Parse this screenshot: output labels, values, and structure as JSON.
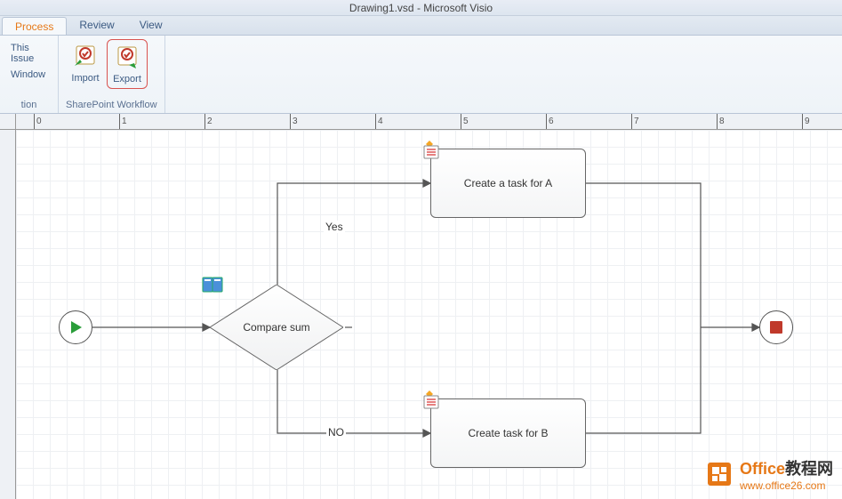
{
  "title": "Drawing1.vsd  -  Microsoft Visio",
  "tabs": [
    "Process",
    "Review",
    "View"
  ],
  "active_tab": "Process",
  "ribbon": {
    "group1": {
      "label": "tion",
      "items": [
        "This Issue",
        "Window"
      ]
    },
    "group2": {
      "label": "SharePoint Workflow",
      "import_label": "Import",
      "export_label": "Export"
    }
  },
  "ruler_numbers": [
    "0",
    "1",
    "2",
    "3",
    "4",
    "5",
    "6",
    "7",
    "8",
    "9"
  ],
  "diagram": {
    "decision_label": "Compare sum",
    "process_a_label": "Create a task for A",
    "process_b_label": "Create task for B",
    "yes_label": "Yes",
    "no_label": "NO"
  },
  "watermark": {
    "brand": "Office",
    "cn_text": "教程网",
    "url": "www.office26.com"
  }
}
